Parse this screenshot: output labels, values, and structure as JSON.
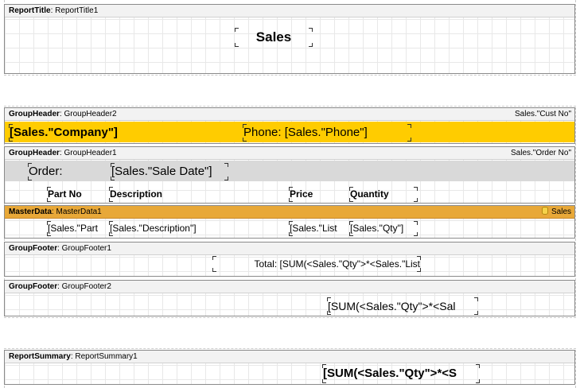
{
  "report_title_band": {
    "type": "ReportTitle",
    "name": "ReportTitle1",
    "title_text": "Sales"
  },
  "group_header_2": {
    "type": "GroupHeader",
    "name": "GroupHeader2",
    "condition": "Sales.\"Cust No\"",
    "company_field": "[Sales.\"Company\"]",
    "phone_field": "Phone: [Sales.\"Phone\"]"
  },
  "group_header_1": {
    "type": "GroupHeader",
    "name": "GroupHeader1",
    "condition": "Sales.\"Order No\"",
    "order_label": "Order:",
    "sale_date_field": "[Sales.\"Sale Date\"]",
    "columns": {
      "part_no": "Part No",
      "description": "Description",
      "price": "Price",
      "quantity": "Quantity"
    }
  },
  "master_data": {
    "type": "MasterData",
    "name": "MasterData1",
    "datasource": "Sales",
    "fields": {
      "part_no": "[Sales.\"Part",
      "description": "[Sales.\"Description\"]",
      "price": "[Sales.\"List",
      "qty": "[Sales.\"Qty\"]"
    }
  },
  "group_footer_1": {
    "type": "GroupFooter",
    "name": "GroupFooter1",
    "total_text": "Total: [SUM(<Sales.\"Qty\">*<Sales.\"List"
  },
  "group_footer_2": {
    "type": "GroupFooter",
    "name": "GroupFooter2",
    "sum_text": "[SUM(<Sales.\"Qty\">*<Sal"
  },
  "report_summary": {
    "type": "ReportSummary",
    "name": "ReportSummary1",
    "sum_text": "[SUM(<Sales.\"Qty\">*<S"
  },
  "colors": {
    "yellow_strip": "#ffcc00",
    "gray_strip": "#d9d9d9",
    "master_header": "#e8a838",
    "band_header": "#f2f2f2"
  }
}
